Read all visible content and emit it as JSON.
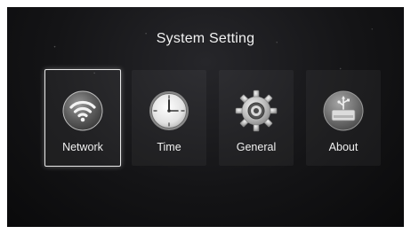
{
  "header": {
    "title": "System Setting"
  },
  "menu": {
    "items": [
      {
        "label": "Network",
        "icon": "wifi-icon",
        "selected": true
      },
      {
        "label": "Time",
        "icon": "clock-icon",
        "selected": false
      },
      {
        "label": "General",
        "icon": "gear-icon",
        "selected": false
      },
      {
        "label": "About",
        "icon": "usb-drive-icon",
        "selected": false
      }
    ]
  }
}
